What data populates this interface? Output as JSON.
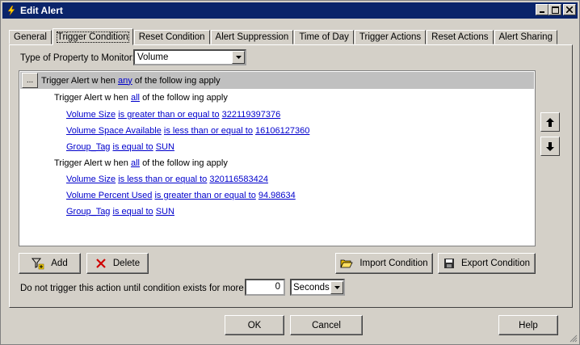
{
  "window": {
    "title": "Edit Alert"
  },
  "tabs": [
    {
      "label": "General"
    },
    {
      "label": "Trigger Condition"
    },
    {
      "label": "Reset Condition"
    },
    {
      "label": "Alert Suppression"
    },
    {
      "label": "Time of Day"
    },
    {
      "label": "Trigger Actions"
    },
    {
      "label": "Reset Actions"
    },
    {
      "label": "Alert Sharing"
    }
  ],
  "property": {
    "label": "Type of Property to Monitor:",
    "value": "Volume"
  },
  "conditions": {
    "root": {
      "ellipsis": "...",
      "prefix": "Trigger Alert w hen",
      "quantifier": "any",
      "suffix": "of the follow ing apply"
    },
    "groups": [
      {
        "prefix": "Trigger Alert w hen",
        "quantifier": "all",
        "suffix": "of the follow ing apply",
        "rules": [
          {
            "field": "Volume Size",
            "op": "is greater than or equal to",
            "value": "322119397376"
          },
          {
            "field": "Volume Space Available",
            "op": "is less than or equal to",
            "value": "16106127360"
          },
          {
            "field": "Group_Tag",
            "op": "is equal to",
            "value": "SUN"
          }
        ]
      },
      {
        "prefix": "Trigger Alert w hen",
        "quantifier": "all",
        "suffix": "of the follow ing apply",
        "rules": [
          {
            "field": "Volume Size",
            "op": "is less than or equal to",
            "value": "320116583424"
          },
          {
            "field": "Volume Percent Used",
            "op": "is greater than or equal to",
            "value": "94.98634"
          },
          {
            "field": "Group_Tag",
            "op": "is equal to",
            "value": "SUN"
          }
        ]
      }
    ]
  },
  "actions": {
    "add": "Add",
    "delete": "Delete",
    "import": "Import Condition",
    "export": "Export Condition"
  },
  "duration": {
    "label": "Do not trigger this action until condition exists for more than",
    "value": "0",
    "unit": "Seconds"
  },
  "footer": {
    "ok": "OK",
    "cancel": "Cancel",
    "help": "Help"
  },
  "colors": {
    "titlebar": "#0a246a",
    "link": "#0000cc",
    "face": "#d4d0c8"
  }
}
